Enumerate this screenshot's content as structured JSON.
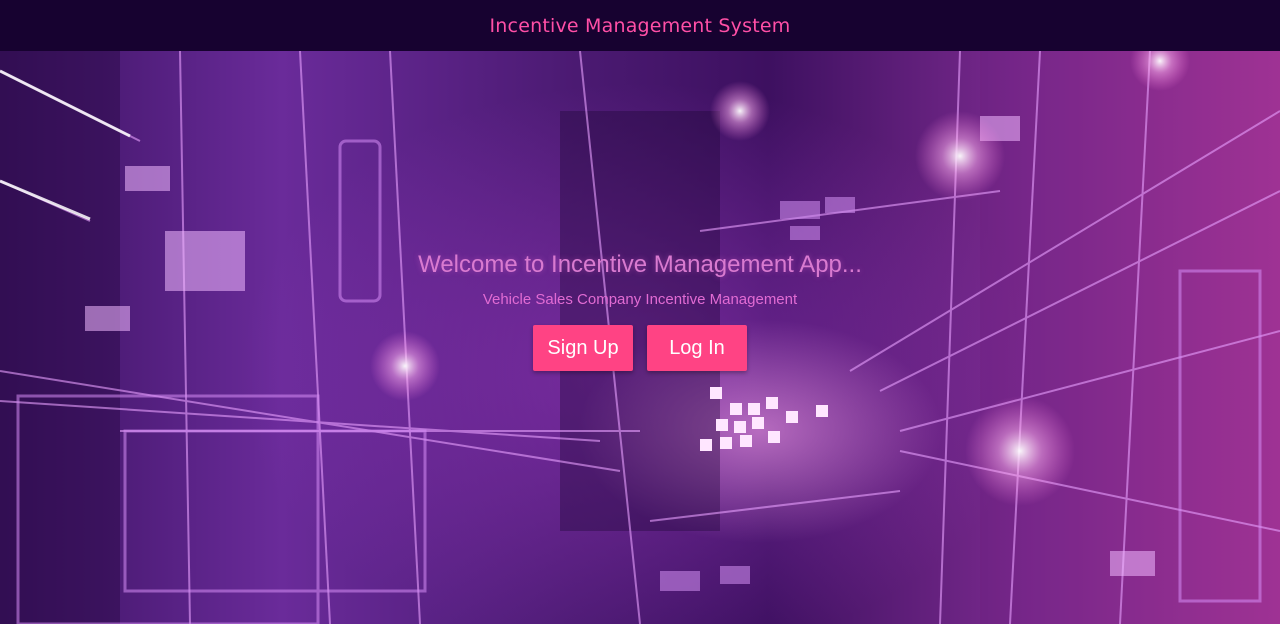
{
  "navbar": {
    "title": "Incentive Management System"
  },
  "hero": {
    "heading": "Welcome to Incentive Management App...",
    "subheading": "Vehicle Sales Company Incentive Management",
    "background": "abstract-purple-neon-grid-image"
  },
  "actions": {
    "signup_label": "Sign Up",
    "login_label": "Log In"
  },
  "colors": {
    "navbar_bg": "#170230",
    "brand": "#ff4fa6",
    "button_bg": "#ff4384",
    "button_text": "#ffffff"
  }
}
